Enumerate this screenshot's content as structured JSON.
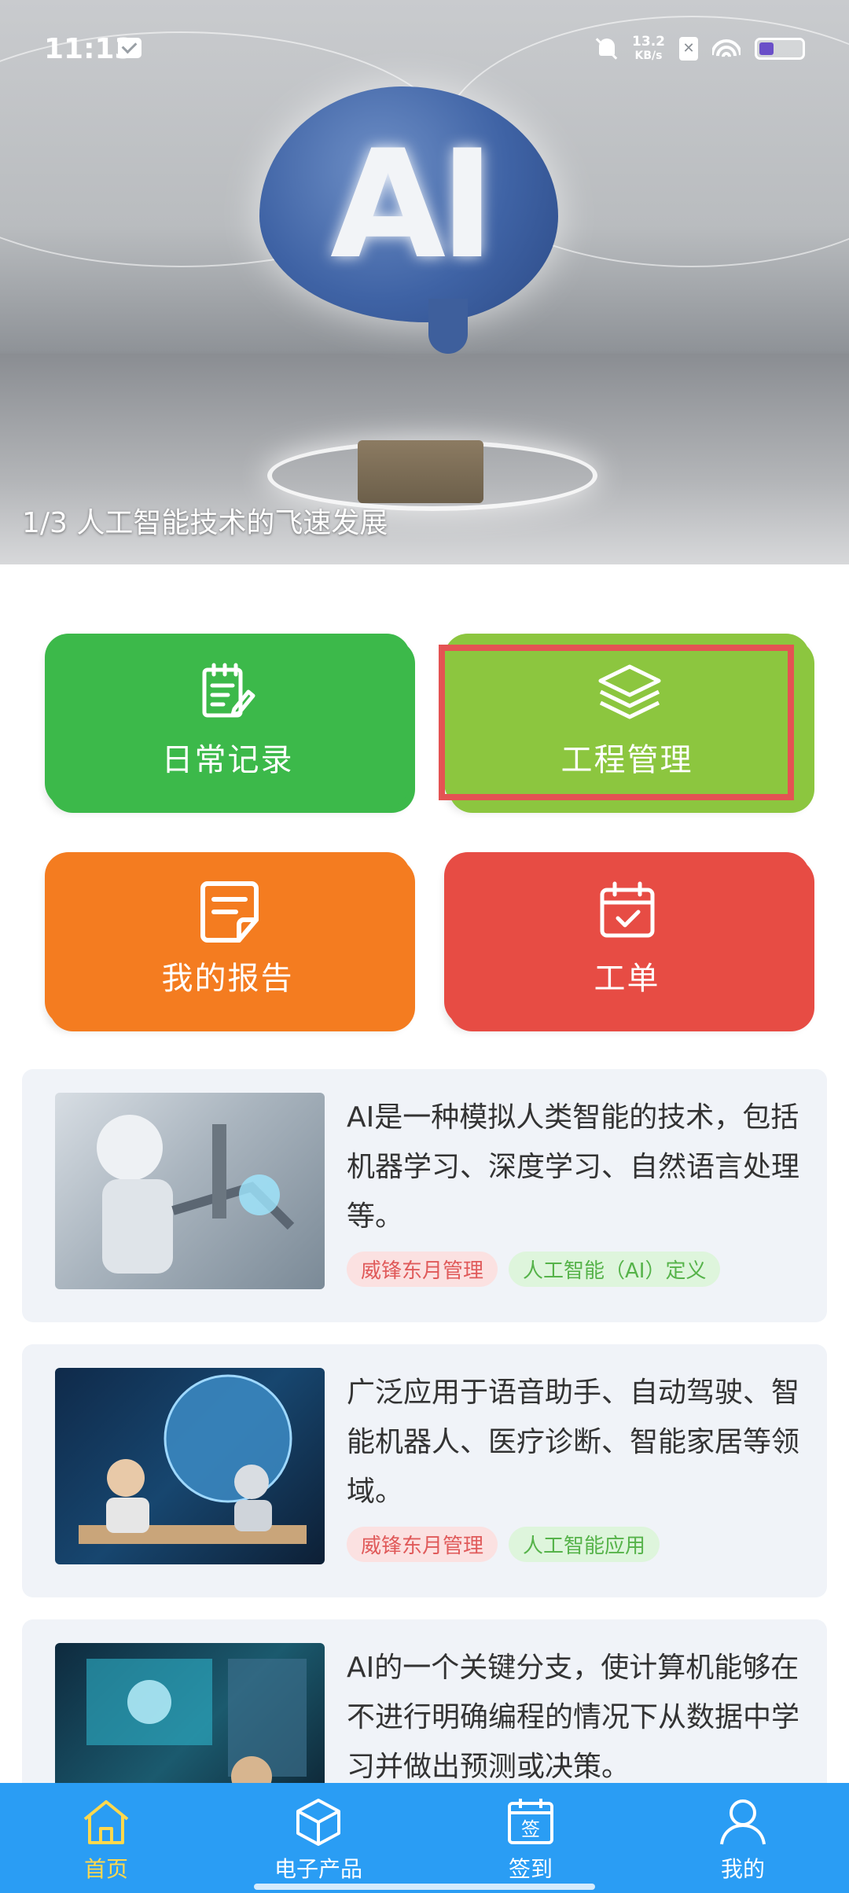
{
  "status_bar": {
    "time": "11:13",
    "speed_value": "13.2",
    "speed_unit": "KB/s",
    "sim_label": "✕",
    "battery_level": 0.35
  },
  "banner": {
    "caption": "1/3 人工智能技术的飞速发展"
  },
  "tiles": [
    {
      "label": "日常记录",
      "icon": "clipboard-edit-icon",
      "color": "#3cb94a"
    },
    {
      "label": "工程管理",
      "icon": "layers-icon",
      "color": "#8cc63f"
    },
    {
      "label": "我的报告",
      "icon": "note-icon",
      "color": "#f47c20"
    },
    {
      "label": "工单",
      "icon": "calendar-check-icon",
      "color": "#e74c44"
    }
  ],
  "cards": [
    {
      "text": "AI是一种模拟人类智能的技术，包括机器学习、深度学习、自然语言处理等。",
      "tags": [
        "威锋东月管理",
        "人工智能（AI）定义"
      ]
    },
    {
      "text": "广泛应用于语音助手、自动驾驶、智能机器人、医疗诊断、智能家居等领域。",
      "tags": [
        "威锋东月管理",
        "人工智能应用"
      ]
    },
    {
      "text": "AI的一个关键分支，使计算机能够在不进行明确编程的情况下从数据中学习并做出预测或决策。",
      "tags": []
    }
  ],
  "bottom_nav": [
    {
      "label": "首页",
      "icon": "home-icon",
      "active": true
    },
    {
      "label": "电子产品",
      "icon": "box-icon",
      "active": false
    },
    {
      "label": "签到",
      "icon": "sign-in-icon",
      "active": false
    },
    {
      "label": "我的",
      "icon": "user-icon",
      "active": false
    }
  ],
  "colors": {
    "nav_background": "#2a9df4",
    "nav_active": "#ffd84d",
    "highlight": "#e45353"
  }
}
